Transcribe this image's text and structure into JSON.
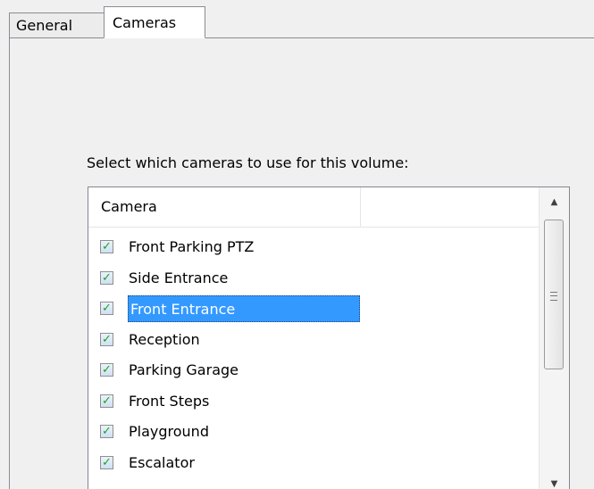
{
  "tabs": [
    {
      "label": "General",
      "active": false
    },
    {
      "label": "Cameras",
      "active": true
    }
  ],
  "prompt": "Select which cameras to use for this volume:",
  "list": {
    "columns": [
      "Camera",
      ""
    ],
    "items": [
      {
        "label": "Front Parking PTZ",
        "checked": true,
        "selected": false
      },
      {
        "label": "Side Entrance",
        "checked": true,
        "selected": false
      },
      {
        "label": "Front Entrance",
        "checked": true,
        "selected": true
      },
      {
        "label": "Reception",
        "checked": true,
        "selected": false
      },
      {
        "label": "Parking Garage",
        "checked": true,
        "selected": false
      },
      {
        "label": "Front Steps",
        "checked": true,
        "selected": false
      },
      {
        "label": "Playground",
        "checked": true,
        "selected": false
      },
      {
        "label": "Escalator",
        "checked": true,
        "selected": false
      }
    ]
  },
  "scrollbar": {
    "up_icon": "scroll-up-arrow-icon",
    "down_icon": "scroll-down-arrow-icon"
  },
  "colors": {
    "selection": "#3399ff",
    "check": "#21a121"
  }
}
